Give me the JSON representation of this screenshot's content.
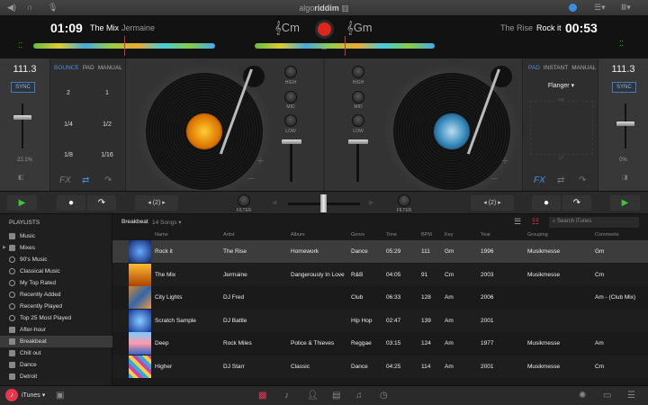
{
  "app": {
    "logo": "algoriddim",
    "logo_bold": "riddim",
    "logo_pre": "algo"
  },
  "topbar": {
    "icons": [
      "speaker-icon",
      "headphones-icon",
      "microphone-icon",
      "record-indicator-icon",
      "layout-menu-icon",
      "columns-menu-icon"
    ]
  },
  "deck_a": {
    "time": "01:09",
    "title": "The Mix",
    "artist": "Jermaine",
    "key": "Cm",
    "bpm": "111.3",
    "sync": "SYNC",
    "pitch": "22.1%",
    "tabs": [
      "BOUNCE",
      "PAD",
      "MANUAL"
    ],
    "active_tab": "BOUNCE",
    "pads": [
      "2",
      "1",
      "1/4",
      "1/2",
      "1/8",
      "1/16"
    ],
    "fx": "FX",
    "loop": "2",
    "filter": "FILTER"
  },
  "deck_b": {
    "time": "00:53",
    "title": "Rock it",
    "artist": "The Rise",
    "key": "Gm",
    "bpm": "111.3",
    "sync": "SYNC",
    "pitch": "0%",
    "tabs": [
      "PAD",
      "INSTANT",
      "MANUAL"
    ],
    "active_tab": "PAD",
    "effect": "Flanger",
    "hp": "HP",
    "lp": "LP",
    "fx": "FX",
    "loop": "2",
    "filter": "FILTER"
  },
  "mixer": {
    "eq": [
      "HIGH",
      "MID",
      "LOW"
    ]
  },
  "sidebar": {
    "title": "PLAYLISTS",
    "items": [
      {
        "label": "Music",
        "icon": "playlist"
      },
      {
        "label": "Mixes",
        "icon": "folder"
      },
      {
        "label": "90's Music",
        "icon": "smart"
      },
      {
        "label": "Classical Music",
        "icon": "smart"
      },
      {
        "label": "My Top Rated",
        "icon": "smart"
      },
      {
        "label": "Recently Added",
        "icon": "smart"
      },
      {
        "label": "Recently Played",
        "icon": "smart"
      },
      {
        "label": "Top 25 Most Played",
        "icon": "smart"
      },
      {
        "label": "After-hour",
        "icon": "playlist"
      },
      {
        "label": "Breakbeat",
        "icon": "playlist",
        "selected": true
      },
      {
        "label": "Chill out",
        "icon": "playlist"
      },
      {
        "label": "Dance",
        "icon": "playlist"
      },
      {
        "label": "Detroit",
        "icon": "playlist"
      }
    ]
  },
  "library": {
    "playlist": "Breakbeat",
    "count": "14 Songs",
    "search_placeholder": "Search iTunes",
    "columns": [
      "Name",
      "Artist",
      "Album",
      "Genre",
      "Time",
      "BPM",
      "Key",
      "Year",
      "Grouping",
      "Comments"
    ],
    "rows": [
      [
        "Rock it",
        "The Rise",
        "Homework",
        "Dance",
        "05:29",
        "111",
        "Gm",
        "1996",
        "Musikmesse",
        "Gm"
      ],
      [
        "The Mix",
        "Jermaine",
        "Dangerously In Love",
        "R&B",
        "04:05",
        "91",
        "Cm",
        "2003",
        "Musikmesse",
        "Cm"
      ],
      [
        "City Lights",
        "DJ Fred",
        "",
        "Club",
        "06:33",
        "128",
        "Am",
        "2006",
        "",
        "Am - (Club Mix)"
      ],
      [
        "Scratch Sample",
        "DJ Battle",
        "",
        "Hip Hop",
        "02:47",
        "139",
        "Am",
        "2001",
        "",
        ""
      ],
      [
        "Deep",
        "Rock Miles",
        "Police & Thieves",
        "Reggae",
        "03:15",
        "124",
        "Am",
        "1977",
        "Musikmesse",
        "Am"
      ],
      [
        "Higher",
        "DJ Starr",
        "Classic",
        "Dance",
        "04:25",
        "114",
        "Am",
        "2001",
        "Musikmesse",
        "Cm"
      ]
    ]
  },
  "bottombar": {
    "source": "iTunes"
  },
  "colors": {
    "accent": "#4a90d9",
    "record": "#e0261c",
    "play": "#3cc43c",
    "itunes": "#e8344e"
  }
}
